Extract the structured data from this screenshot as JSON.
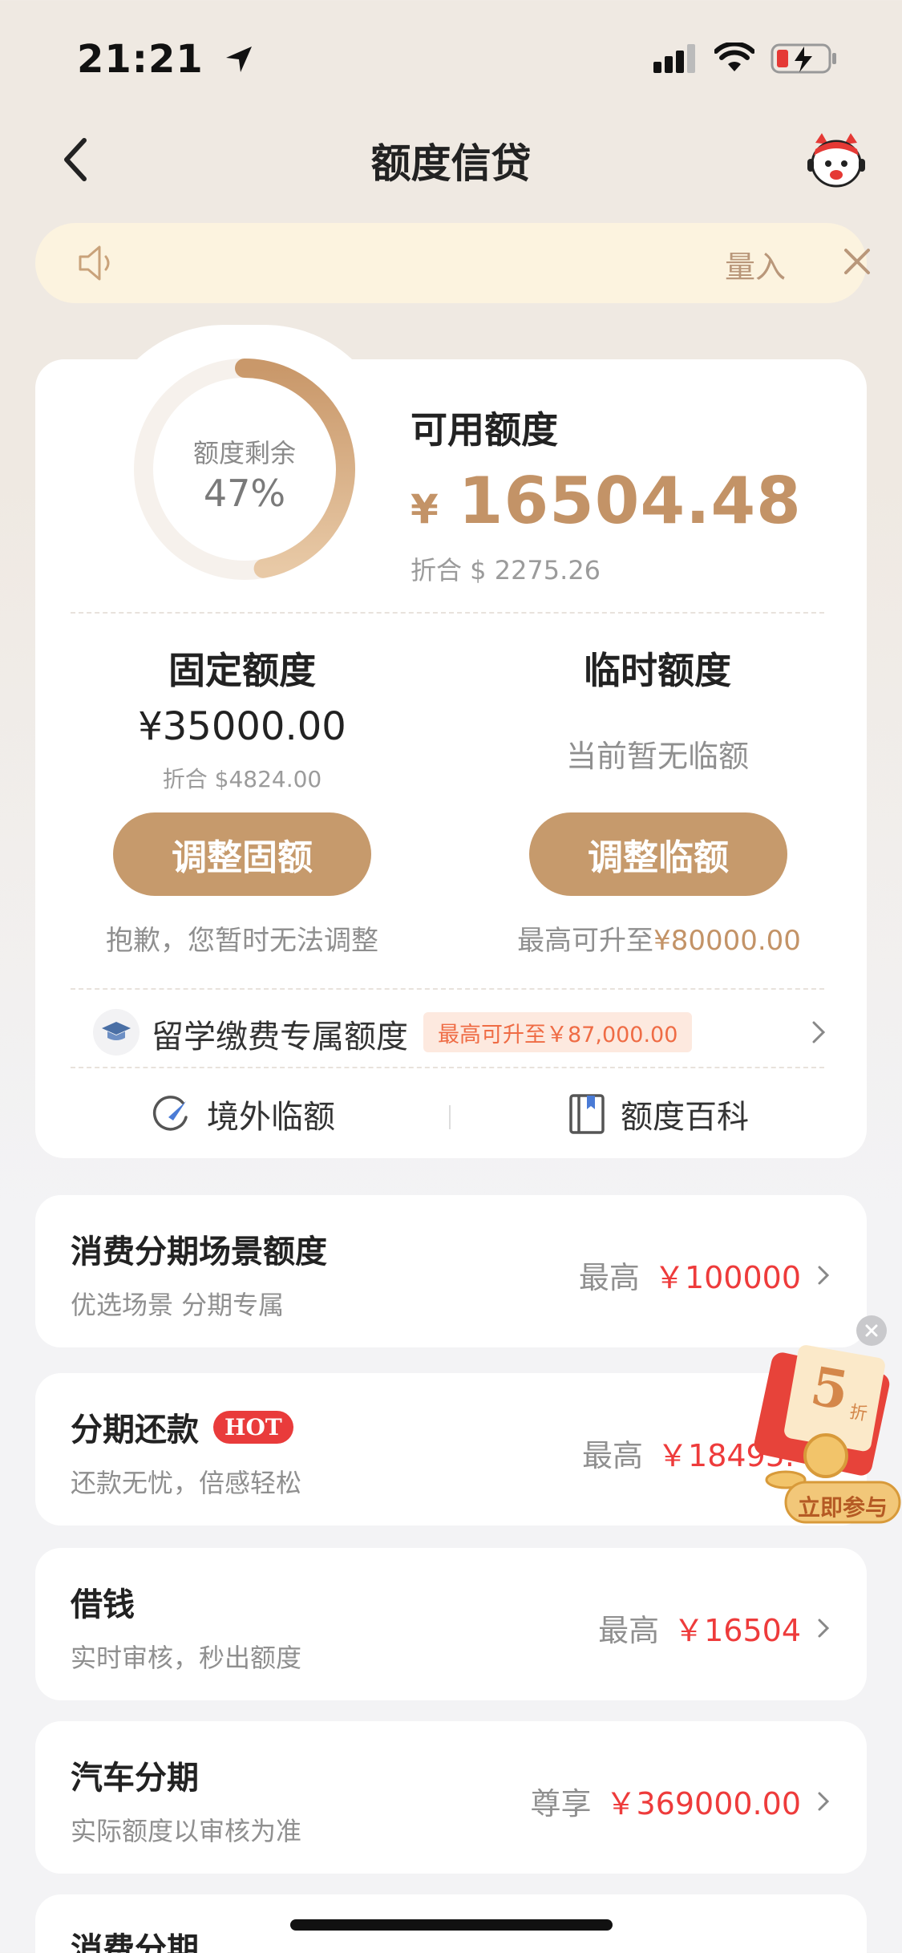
{
  "status_bar": {
    "time": "21:21"
  },
  "nav": {
    "title": "额度信贷"
  },
  "notice": {
    "text": "量入"
  },
  "credit": {
    "ring_label": "额度剩余",
    "ring_percent": "47%",
    "ring_fraction": 0.47,
    "available_label": "可用额度",
    "available_currency": "¥",
    "available_amount": "16504.48",
    "available_usd": "折合 $ 2275.26"
  },
  "fixed": {
    "title": "固定额度",
    "amount": "¥35000.00",
    "usd": "折合 $4824.00",
    "button": "调整固额",
    "note": "抱歉，您暂时无法调整"
  },
  "temporary": {
    "title": "临时额度",
    "status": "当前暂无临额",
    "button": "调整临额",
    "note_prefix": "最高可升至",
    "note_value": "¥80000.00"
  },
  "study": {
    "label": "留学缴费专属额度",
    "tag": "最高可升至￥87,000.00"
  },
  "links": {
    "overseas": "境外临额",
    "encyclopedia": "额度百科"
  },
  "list": [
    {
      "title": "消费分期场景额度",
      "sub": "优选场景 分期专属",
      "prefix": "最高",
      "value": "￥100000"
    },
    {
      "title": "分期还款",
      "badge": "HOT",
      "sub": "还款无忧，倍感轻松",
      "prefix": "最高",
      "value": "￥18495."
    },
    {
      "title": "借钱",
      "sub": "实时审核，秒出额度",
      "prefix": "最高",
      "value": "￥16504"
    },
    {
      "title": "汽车分期",
      "sub": "实际额度以审核为准",
      "prefix": "尊享",
      "value": "￥369000.00"
    },
    {
      "title": "消费分期"
    }
  ],
  "promo": {
    "number": "5",
    "unit": "折",
    "cta": "立即参与"
  },
  "colors": {
    "gold": "#c39367",
    "button": "#c69a6c",
    "red": "#ee3b3b",
    "notice_bg": "#fcf3df"
  }
}
